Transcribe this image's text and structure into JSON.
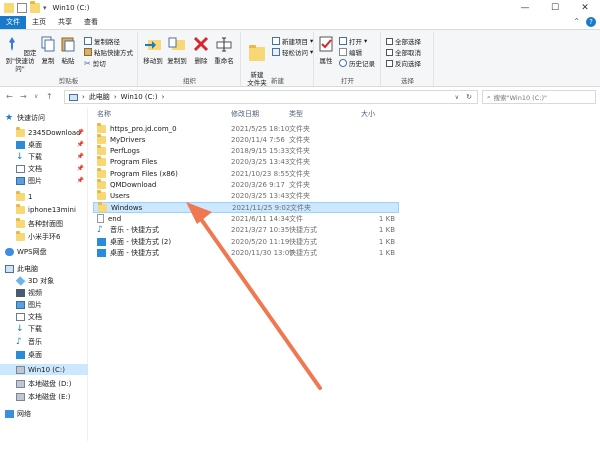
{
  "window": {
    "title": "Win10 (C:)"
  },
  "tabs": [
    "文件",
    "主页",
    "共享",
    "查看"
  ],
  "ribbon": {
    "clipboard": {
      "pin": "固定到\"快速访问\"",
      "copy": "复制",
      "paste": "粘贴",
      "copy_path": "复制路径",
      "paste_shortcut": "粘贴快捷方式",
      "cut": "剪切",
      "caption": "剪贴板"
    },
    "organize": {
      "move": "移动到",
      "copy_to": "复制到",
      "delete": "删除",
      "rename": "重命名",
      "caption": "组织"
    },
    "new": {
      "new_folder": "新建\n文件夹",
      "new_item": "新建项目",
      "easy_access": "轻松访问",
      "caption": "新建"
    },
    "open": {
      "properties": "属性",
      "open": "打开",
      "edit": "编辑",
      "history": "历史记录",
      "caption": "打开"
    },
    "select": {
      "select_all": "全部选择",
      "select_none": "全部取消",
      "invert": "反向选择",
      "caption": "选择"
    }
  },
  "address": {
    "path": [
      "此电脑",
      "Win10 (C:)"
    ],
    "search_placeholder": "搜索\"Win10 (C:)\""
  },
  "nav": [
    {
      "label": "快速访问",
      "icon": "star-icon"
    },
    {
      "label": "2345Download",
      "icon": "folder-icon"
    },
    {
      "label": "桌面",
      "icon": "desktop-icon"
    },
    {
      "label": "下载",
      "icon": "download-icon"
    },
    {
      "label": "文档",
      "icon": "document-icon"
    },
    {
      "label": "图片",
      "icon": "picture-icon"
    },
    {
      "label": "1",
      "icon": "folder-icon"
    },
    {
      "label": "iphone13mini",
      "icon": "folder-icon"
    },
    {
      "label": "各种封面图",
      "icon": "folder-icon"
    },
    {
      "label": "小米手环6",
      "icon": "folder-icon"
    },
    {
      "label": "WPS网盘",
      "icon": "cloud-icon"
    },
    {
      "label": "此电脑",
      "icon": "computer-icon"
    },
    {
      "label": "3D 对象",
      "icon": "cube-icon"
    },
    {
      "label": "视频",
      "icon": "video-icon"
    },
    {
      "label": "图片",
      "icon": "picture-icon"
    },
    {
      "label": "文档",
      "icon": "document-icon"
    },
    {
      "label": "下载",
      "icon": "download-icon"
    },
    {
      "label": "音乐",
      "icon": "music-icon"
    },
    {
      "label": "桌面",
      "icon": "desktop-icon"
    },
    {
      "label": "Win10 (C:)",
      "icon": "drive-icon"
    },
    {
      "label": "本地磁盘 (D:)",
      "icon": "drive-icon"
    },
    {
      "label": "本地磁盘 (E:)",
      "icon": "drive-icon"
    },
    {
      "label": "网络",
      "icon": "network-icon"
    }
  ],
  "columns": {
    "name": "名称",
    "date": "修改日期",
    "type": "类型",
    "size": "大小"
  },
  "files": [
    {
      "name": "https_pro.jd.com_0",
      "date": "2021/5/25 18:10",
      "type": "文件夹",
      "size": "",
      "icon": "folder-icon"
    },
    {
      "name": "MyDrivers",
      "date": "2020/11/4 7:56",
      "type": "文件夹",
      "size": "",
      "icon": "folder-icon"
    },
    {
      "name": "PerfLogs",
      "date": "2018/9/15 15:33",
      "type": "文件夹",
      "size": "",
      "icon": "folder-icon"
    },
    {
      "name": "Program Files",
      "date": "2020/3/25 13:43",
      "type": "文件夹",
      "size": "",
      "icon": "folder-icon"
    },
    {
      "name": "Program Files (x86)",
      "date": "2021/10/23 8:55",
      "type": "文件夹",
      "size": "",
      "icon": "folder-icon"
    },
    {
      "name": "QMDownload",
      "date": "2020/3/26 9:17",
      "type": "文件夹",
      "size": "",
      "icon": "folder-icon"
    },
    {
      "name": "Users",
      "date": "2020/3/25 13:43",
      "type": "文件夹",
      "size": "",
      "icon": "folder-icon"
    },
    {
      "name": "Windows",
      "date": "2021/11/25 9:02",
      "type": "文件夹",
      "size": "",
      "icon": "folder-icon"
    },
    {
      "name": "end",
      "date": "2021/6/11 14:34",
      "type": "文件",
      "size": "1 KB",
      "icon": "file-icon"
    },
    {
      "name": "音乐 - 快捷方式",
      "date": "2021/3/27 10:35",
      "type": "快捷方式",
      "size": "1 KB",
      "icon": "music-shortcut-icon"
    },
    {
      "name": "桌面 - 快捷方式 (2)",
      "date": "2020/5/20 11:19",
      "type": "快捷方式",
      "size": "1 KB",
      "icon": "desktop-shortcut-icon"
    },
    {
      "name": "桌面 - 快捷方式",
      "date": "2020/11/30 13:07",
      "type": "快捷方式",
      "size": "1 KB",
      "icon": "desktop-shortcut-icon"
    }
  ],
  "selected_file": "Windows",
  "colors": {
    "accent": "#1979ca",
    "selection": "#cce8ff",
    "annotation_arrow": "#f07850"
  }
}
